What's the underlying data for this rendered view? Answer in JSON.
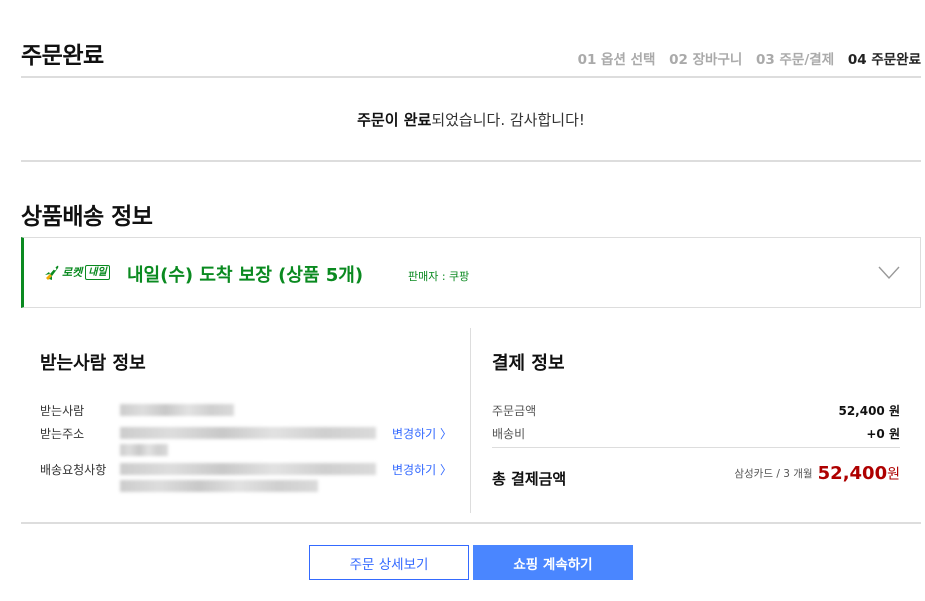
{
  "header": {
    "title": "주문완료",
    "steps": [
      {
        "label": "01 옵션 선택",
        "current": false
      },
      {
        "label": "02 장바구니",
        "current": false
      },
      {
        "label": "03 주문/결제",
        "current": false
      },
      {
        "label": "04 주문완료",
        "current": true
      }
    ]
  },
  "complete": {
    "bold": "주문이 완료",
    "rest": "되었습니다. 감사합니다!"
  },
  "delivery": {
    "section_title": "상품배송 정보",
    "rocket_label": "로켓",
    "rocket_badge": "내일",
    "main": "내일(수) 도착 보장 (상품 5개)",
    "seller": "판매자 : 쿠팡"
  },
  "receiver": {
    "title": "받는사람 정보",
    "name_label": "받는사람",
    "address_label": "받는주소",
    "request_label": "배송요청사항",
    "change_label": "변경하기 〉"
  },
  "payment": {
    "title": "결제 정보",
    "order_amount_label": "주문금액",
    "order_amount_value": "52,400 원",
    "shipping_label": "배송비",
    "shipping_value": "+0 원",
    "total_label": "총 결제금액",
    "total_card": "삼성카드 / 3 개월",
    "total_amount": "52,400",
    "total_unit": "원"
  },
  "buttons": {
    "detail": "주문 상세보기",
    "continue": "쇼핑 계속하기"
  },
  "colors": {
    "rocket_green": "#0a8a20",
    "accent_blue": "#346aff",
    "price_red": "#ae0000"
  }
}
